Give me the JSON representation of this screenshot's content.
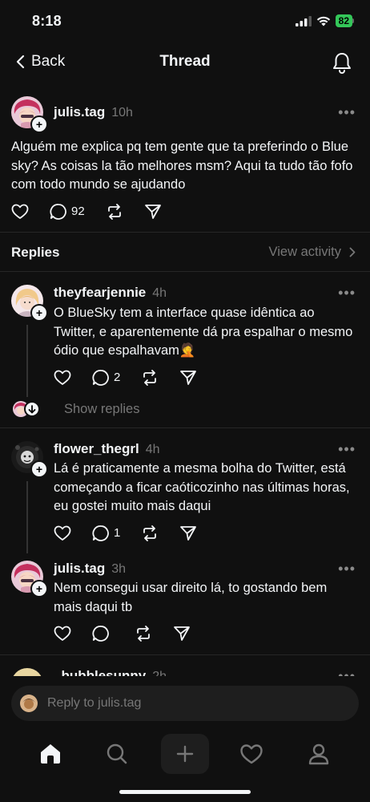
{
  "status_bar": {
    "time": "8:18",
    "battery": "82"
  },
  "header": {
    "back_label": "Back",
    "title": "Thread"
  },
  "post": {
    "username": "julis.tag",
    "time_ago": "10h",
    "text": "Alguém me explica pq tem gente que ta preferindo o Blue sky? As coisas la tão melhores msm? Aqui ta tudo tão fofo com todo mundo se ajudando",
    "comment_count": "92"
  },
  "replies_header": {
    "label": "Replies",
    "view_activity": "View activity"
  },
  "replies": [
    {
      "username": "theyfearjennie",
      "time_ago": "4h",
      "text": "O BlueSky tem a interface quase idêntica ao Twitter, e aparentemente dá pra espalhar o mesmo ódio que espalhavam🤦",
      "comment_count": "2",
      "show_replies": "Show replies"
    },
    {
      "username": "flower_thegrl",
      "time_ago": "4h",
      "text": "Lá é praticamente a mesma bolha do Twitter, está começando a ficar caóticozinho nas últimas horas, eu gostei muito mais daqui",
      "comment_count": "1"
    },
    {
      "username": "julis.tag",
      "time_ago": "3h",
      "text": "Nem consegui usar direito lá, to gostando bem mais daqui tb",
      "comment_count": ""
    },
    {
      "username": "_bubblesunny",
      "time_ago": "2h"
    }
  ],
  "reply_bar": {
    "placeholder": "Reply to julis.tag"
  },
  "tabs": [
    "home-icon",
    "search-icon",
    "plus-icon",
    "heart-icon",
    "profile-icon"
  ],
  "colors": {
    "background": "#101010",
    "text": "#f3f5f7",
    "muted": "#777777",
    "battery": "#34c759"
  }
}
